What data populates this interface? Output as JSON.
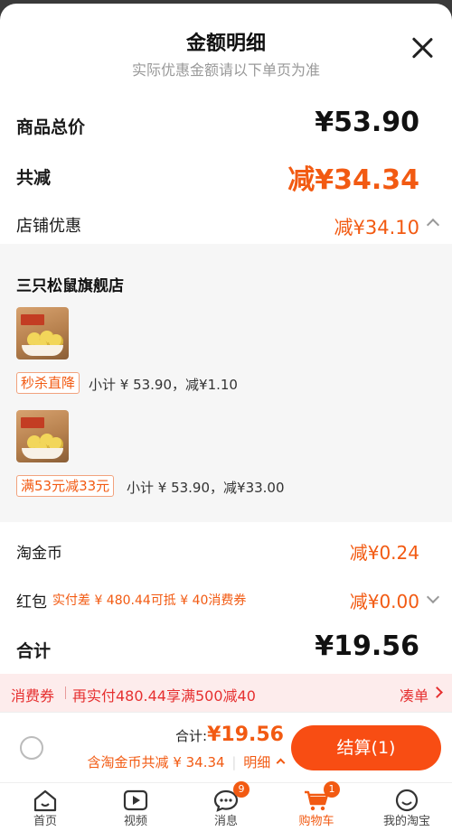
{
  "header": {
    "title": "金额明细",
    "subtitle": "实际优惠金额请以下单页为准"
  },
  "summary": {
    "total_label": "商品总价",
    "total_value": "¥53.90",
    "reduce_label": "共减",
    "reduce_value": "减¥34.34",
    "shop_discount_label": "店铺优惠",
    "shop_discount_value": "减¥34.10"
  },
  "store": {
    "name": "三只松鼠旗舰店",
    "items": [
      {
        "tag": "秒杀直降",
        "detail": "小计 ¥ 53.90，减¥1.10"
      },
      {
        "tag": "满53元减33元",
        "detail": "小计 ¥ 53.90，减¥33.00"
      }
    ]
  },
  "extras": {
    "coins_label": "淘金币",
    "coins_value": "减¥0.24",
    "redpacket_label": "红包",
    "redpacket_note": "实付差 ¥ 480.44可抵 ¥ 40消费券",
    "redpacket_value": "减¥0.00",
    "sum_label": "合计",
    "sum_value": "¥19.56"
  },
  "coupon_bar": {
    "label": "消费券",
    "text": "再实付480.44享满500减40",
    "action": "凑单"
  },
  "checkout": {
    "total_prefix": "合计:",
    "total_value": "¥19.56",
    "discount_text": "含淘金币共减 ¥ 34.34",
    "detail_label": "明细",
    "pay_button": "结算(1)"
  },
  "tabbar": [
    {
      "name": "首页",
      "icon": "home-icon"
    },
    {
      "name": "视频",
      "icon": "video-icon"
    },
    {
      "name": "消息",
      "icon": "message-icon",
      "badge": "9"
    },
    {
      "name": "购物车",
      "icon": "cart-icon",
      "badge": "1"
    },
    {
      "name": "我的淘宝",
      "icon": "profile-icon"
    }
  ],
  "colors": {
    "accent": "#f25a12",
    "button": "#f84d13",
    "coupon": "#e63030"
  }
}
